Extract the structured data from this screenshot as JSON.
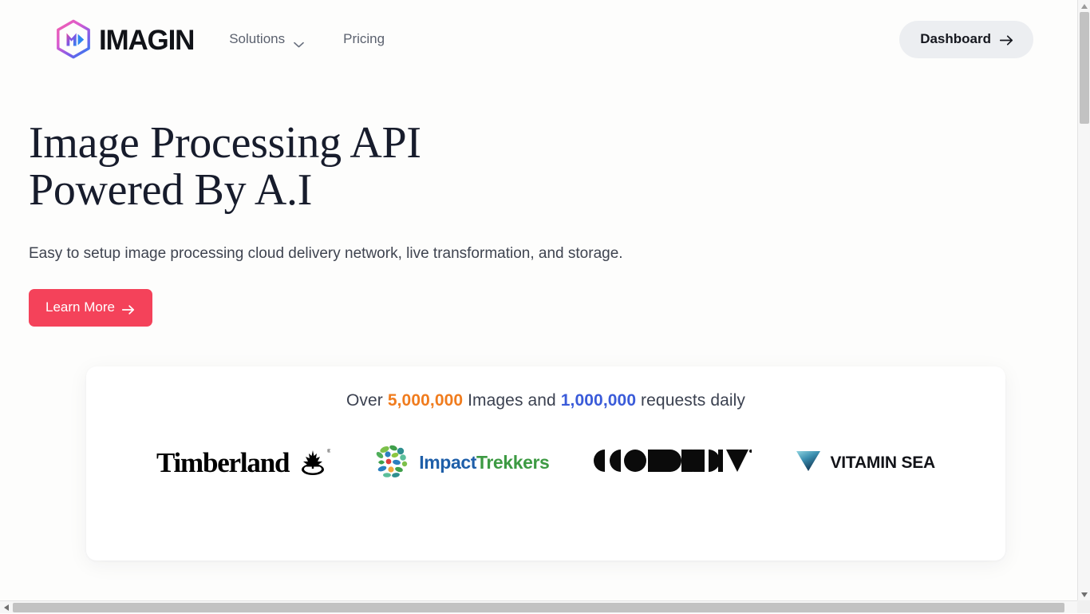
{
  "brand": {
    "name": "IMAGIN",
    "logo_icon": "hexagon-m-logo"
  },
  "nav": {
    "items": [
      {
        "label": "Solutions",
        "has_dropdown": true,
        "icon": "chevron-down-icon"
      },
      {
        "label": "Pricing",
        "has_dropdown": false
      }
    ],
    "dashboard_label": "Dashboard",
    "dashboard_icon": "arrow-right-icon"
  },
  "hero": {
    "heading": "Image Processing API\nPowered By A.I",
    "subheading": "Easy to setup image processing cloud delivery network, live transformation, and storage.",
    "cta_label": "Learn More",
    "cta_icon": "arrow-right-icon"
  },
  "stats": {
    "prefix": "Over",
    "images_count": "5,000,000",
    "middle": "Images and",
    "requests_count": "1,000,000",
    "suffix": "requests daily"
  },
  "logos": [
    {
      "name": "Timberland",
      "text": "Timberland",
      "icon": "timberland-tree-icon"
    },
    {
      "name": "ImpactTrekkers",
      "text_primary": "Impact",
      "text_secondary": "Trekkers",
      "icon": "impact-mosaic-circle-icon"
    },
    {
      "name": "Geometria",
      "text": "GEOMETRIA",
      "icon": "geometric-wordmark"
    },
    {
      "name": "Vitamin Sea",
      "text": "VITAMIN SEA",
      "icon": "vitamin-sea-triangle-icon"
    }
  ],
  "colors": {
    "accent_red": "#f4425a",
    "images_orange": "#f07c1e",
    "requests_blue": "#3a5bd9",
    "heading_navy": "#171c2c",
    "page_bg": "#fdfdfc",
    "button_gray": "#eceef1"
  },
  "scrollbars": {
    "vertical_icon_up": "scroll-up-arrow-icon",
    "vertical_icon_down": "scroll-down-arrow-icon",
    "horizontal_icon_left": "scroll-left-arrow-icon",
    "horizontal_icon_right": "scroll-right-arrow-icon"
  }
}
